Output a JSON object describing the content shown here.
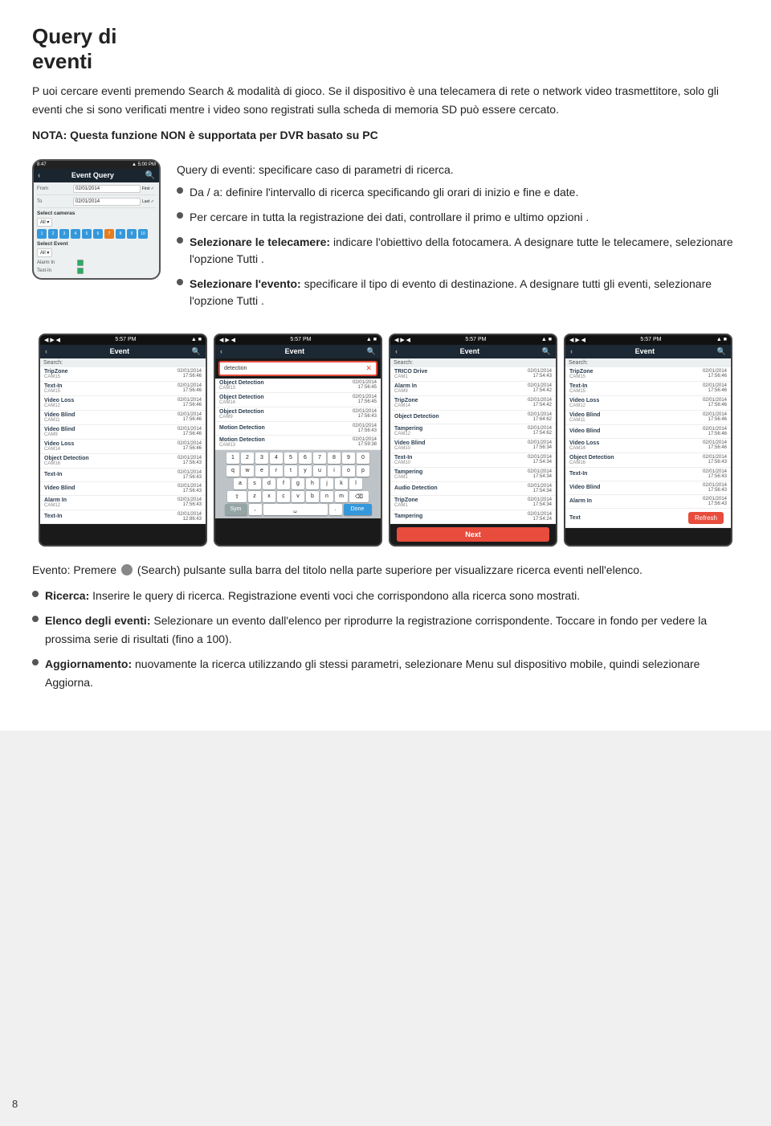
{
  "page": {
    "number": "8",
    "title_line1": "Query di",
    "title_line2": "eventi",
    "intro": "P uoi cercare eventi premendo  Search & modalità di gioco. Se il dispositivo è una telecamera di rete o network video trasmettitore, solo gli eventi che si sono verificati mentre i video sono registrati sulla scheda di memoria SD può essere cercato.",
    "nota": "NOTA: Questa funzione NON è supportata per DVR basato su PC",
    "query_label": "Query di eventi: specificare caso di parametri di ricerca.",
    "bullet1": "Da / a: definire l'intervallo di ricerca specificando gli orari di inizio e fine e date.",
    "bullet2": "Per cercare in tutta la registrazione dei dati, controllare il primo e  ultimo opzioni .",
    "bullet3_prefix": "Selezionare le telecamere:",
    "bullet3_suffix": " indicare l'obiettivo della fotocamera. A designare tutte le telecamere, selezionare l'opzione Tutti .",
    "bullet4_prefix": "Selezionare l'evento:",
    "bullet4_suffix": " specificare il tipo di evento di destinazione. A designare tutti gli eventi, selezionare l'opzione Tutti .",
    "phone_title": "Event Query",
    "phone_from_label": "From",
    "phone_from_first": "First",
    "phone_to_label": "To",
    "phone_to_last": "Last",
    "phone_select_cameras": "Select cameras",
    "phone_select_event": "Select Event",
    "channel_nums": [
      "1",
      "2",
      "3",
      "4",
      "5",
      "6",
      "7",
      "8",
      "9",
      "0"
    ],
    "alarm_in": "Alarm In",
    "text_in": "Text-In",
    "event_label": "Event"
  },
  "screenshots": {
    "ss1": {
      "time": "5:57 PM",
      "title": "Event",
      "search_placeholder": "Search:",
      "items": [
        {
          "name": "TripZone",
          "cam": "CAM15",
          "time": "02/01/2014 17:56:46"
        },
        {
          "name": "Text-In",
          "cam": "CAM15",
          "time": "02/01/2014 17:56:46"
        },
        {
          "name": "Video Loss",
          "cam": "CAM12",
          "time": "02/01/2014 17:56:46"
        },
        {
          "name": "Video Blind",
          "cam": "CAM11",
          "time": "02/01/2014 17:56:46"
        },
        {
          "name": "Video Blind",
          "cam": "CAM9",
          "time": "02/01/2014 17:56:46"
        },
        {
          "name": "Video Loss",
          "cam": "CAM14",
          "time": "02/01/2014 17:56:46"
        },
        {
          "name": "Object Detection",
          "cam": "CAM16",
          "time": "02/01/2014 17:56:43"
        },
        {
          "name": "Text-In",
          "cam": "",
          "time": "02/01/2014 17:56:43"
        },
        {
          "name": "Video Blind",
          "cam": "",
          "time": "02/01/2014 17:56:43"
        },
        {
          "name": "Alarm In",
          "cam": "CAM12",
          "time": "02/01/2014 17:56:43"
        },
        {
          "name": "Text-In",
          "cam": "",
          "time": "02/01/2014 17:86:43"
        }
      ]
    },
    "ss2": {
      "time": "5:57 PM",
      "title": "Event",
      "search_text": "detection",
      "items": [
        {
          "name": "Object Detection",
          "cam": "CAM13",
          "time": "02/01/2014 17:56:45"
        },
        {
          "name": "Object Detection",
          "cam": "CAM14",
          "time": "02/01/2014 17:56:45"
        },
        {
          "name": "Object Detection",
          "cam": "CAM9",
          "time": "02/01/2014 17:56:43"
        },
        {
          "name": "Motion Detection",
          "cam": "",
          "time": "02/01/2014 17:56:43"
        },
        {
          "name": "Motion Detection",
          "cam": "CAM13",
          "time": "02/01/2014 17:59:38"
        }
      ],
      "keyboard": true
    },
    "ss3": {
      "time": "5:57 PM",
      "title": "Event",
      "search_placeholder": "Search:",
      "items": [
        {
          "name": "Trico Drive",
          "cam": "CAM1",
          "time": "02/01/2014 17:54:43"
        },
        {
          "name": "Alarm In",
          "cam": "CAM9",
          "time": "02/01/2014 17:54:42"
        },
        {
          "name": "TripZone",
          "cam": "CAM14",
          "time": "02/01/2014 17:54:42"
        },
        {
          "name": "Object Detection",
          "cam": "",
          "time": "02/01/2014 17:64:62"
        },
        {
          "name": "Tampering",
          "cam": "CAM12",
          "time": "02/01/2014 17:54:62"
        },
        {
          "name": "Video Blind",
          "cam": "CAM10",
          "time": "02/01/2014 17:56:34"
        },
        {
          "name": "Text-In",
          "cam": "CAM10",
          "time": "02/01/2014 17:54:34"
        },
        {
          "name": "Tampering",
          "cam": "CAM1",
          "time": "02/01/2014 17:54:34"
        },
        {
          "name": "Audio Detection",
          "cam": "",
          "time": "02/01/2014 17:54:34"
        },
        {
          "name": "TripZone",
          "cam": "CAM1",
          "time": "02/01/2014 17:54:34"
        },
        {
          "name": "Tampering",
          "cam": "",
          "time": "02/01/2014 17:54:24"
        }
      ],
      "next_btn": "Next"
    },
    "ss4": {
      "time": "5:57 PM",
      "title": "Event",
      "search_placeholder": "Search:",
      "items": [
        {
          "name": "TripZone",
          "cam": "CAM15",
          "time": "02/01/2014 17:56:46"
        },
        {
          "name": "Text-In",
          "cam": "CAM15",
          "time": "02/01/2014 17:56:46"
        },
        {
          "name": "Video Loss",
          "cam": "CAM12",
          "time": "02/01/2014 17:56:46"
        },
        {
          "name": "Video Blind",
          "cam": "CAM11",
          "time": "02/01/2014 17:56:46"
        },
        {
          "name": "Video Blind",
          "cam": "",
          "time": "02/01/2014 17:56:46"
        },
        {
          "name": "Video Loss",
          "cam": "CAM14",
          "time": "02/01/2014 17:56:46"
        },
        {
          "name": "Object Detection",
          "cam": "CAM16",
          "time": "02/01/2014 17:56:43"
        },
        {
          "name": "Text-In",
          "cam": "",
          "time": "02/01/2014 17:56:43"
        },
        {
          "name": "Video Blind",
          "cam": "",
          "time": "02/01/2014 17:56:43"
        },
        {
          "name": "Alarm In",
          "cam": "",
          "time": "02/01/2014 17:56:43"
        }
      ],
      "refresh_btn": "Refresh"
    }
  },
  "bottom": {
    "evento_prefix": "Evento: Premere ",
    "evento_middle": " (Search) pulsante sulla barra del titolo nella parte superiore per visualizzare ricerca eventi nell'elenco.",
    "ricerca_title": "Ricerca:",
    "ricerca_text": " Inserire le query di ricerca. Registrazione eventi voci che corrispondono alla ricerca sono mostrati.",
    "elenco_title": "Elenco degli eventi:",
    "elenco_text": " Selezionare un evento dall'elenco per riprodurre la registrazione corrispondente. Toccare  in fondo per vedere la prossima serie di risultati (fino a 100).",
    "aggiornamento_title": "Aggiornamento:",
    "aggiornamento_text": " nuovamente la ricerca utilizzando gli stessi parametri, selezionare Menu sul dispositivo mobile, quindi selezionare Aggiorna."
  }
}
